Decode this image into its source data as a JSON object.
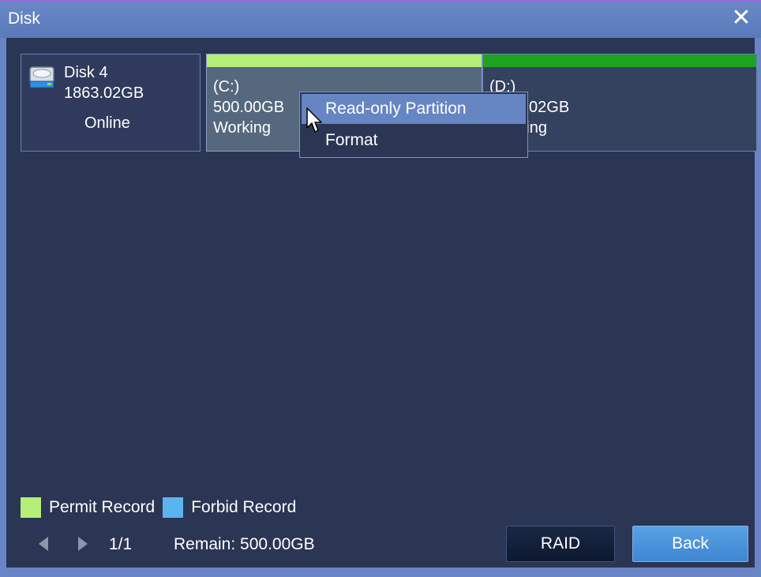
{
  "window": {
    "title": "Disk",
    "close_icon": "close-icon"
  },
  "disk": {
    "name": "Disk 4",
    "size": "1863.02GB",
    "status": "Online",
    "icon": "hard-disk-icon"
  },
  "partitions": [
    {
      "name": "(C:)",
      "size": "500.00GB",
      "status": "Working",
      "bar_color": "#b4ee78"
    },
    {
      "name": "(D:)",
      "size": "1363.02GB",
      "status": "Working",
      "bar_color": "#1ea31e"
    }
  ],
  "context_menu": {
    "items": [
      {
        "label": "Read-only  Partition"
      },
      {
        "label": "Format"
      }
    ]
  },
  "legend": [
    {
      "label": "Permit  Record",
      "color": "#b4ee78"
    },
    {
      "label": "Forbid  Record",
      "color": "#5bb4ee"
    }
  ],
  "pagination": {
    "page": "1/1"
  },
  "remain": "Remain:  500.00GB",
  "buttons": {
    "raid": "RAID",
    "back": "Back"
  }
}
